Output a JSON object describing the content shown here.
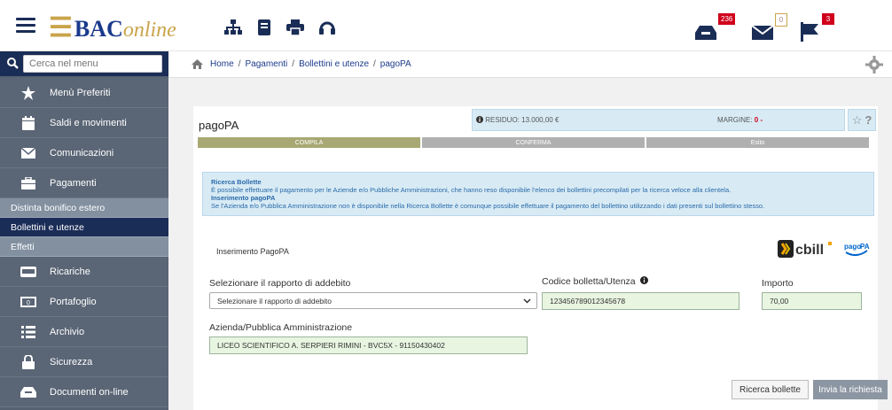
{
  "header": {
    "logo_bac": "BAC",
    "logo_online": "online",
    "notifications": [
      {
        "name": "inbox-icon",
        "count": "236"
      },
      {
        "name": "mail-icon",
        "count": "0"
      },
      {
        "name": "flag-icon",
        "count": "3"
      }
    ]
  },
  "sidebar": {
    "search_placeholder": "Cerca nel menu",
    "items": [
      {
        "icon": "star-icon",
        "label": "Menù Preferiti"
      },
      {
        "icon": "calendar-icon",
        "label": "Saldi e movimenti"
      },
      {
        "icon": "envelope-icon",
        "label": "Comunicazioni"
      },
      {
        "icon": "briefcase-icon",
        "label": "Pagamenti"
      }
    ],
    "subitems": [
      {
        "label": "Distinta bonifico estero",
        "active": false
      },
      {
        "label": "Bollettini e utenze",
        "active": true
      },
      {
        "label": "Effetti",
        "active": false
      }
    ],
    "items2": [
      {
        "icon": "card-icon",
        "label": "Ricariche"
      },
      {
        "icon": "wallet-icon",
        "label": "Portafoglio"
      },
      {
        "icon": "list-icon",
        "label": "Archivio"
      },
      {
        "icon": "lock-icon",
        "label": "Sicurezza"
      },
      {
        "icon": "inbox-icon",
        "label": "Documenti on-line"
      }
    ]
  },
  "breadcrumb": [
    "Home",
    "Pagamenti",
    "Bollettini e utenze",
    "pagoPA"
  ],
  "page": {
    "title": "pagoPA",
    "residuo_label": "RESIDUO: 13.000,00 €",
    "margine_label": "MARGINE:",
    "margine_value": "0 -",
    "steps": [
      "COMPILA",
      "CONFERMA",
      "Esito"
    ],
    "note": {
      "title1": "Ricerca Bollette",
      "text1": "È possibile effettuare il pagamento per le Aziende e/o Pubbliche Amministrazioni, che hanno reso disponibile l'elenco dei bollettini precompilati per la ricerca veloce alla clientela.",
      "title2": "Inserimento pagoPA",
      "text2": "Se l'Azienda e/o Pubblica Amministrazione non è disponibile nella Ricerca Bollette è comunque possibile effettuare il pagamento del bollettino utilizzando i dati presenti sul bollettino stesso."
    },
    "section_label": "Inserimento PagoPA",
    "form": {
      "rapporto_label": "Selezionare il rapporto di addebito",
      "rapporto_value": "Selezionare il rapporto di addebito",
      "codice_label": "Codice bolletta/Utenza",
      "codice_value": "123456789012345678",
      "importo_label": "Importo",
      "importo_value": "70,00",
      "azienda_label": "Azienda/Pubblica Amministrazione",
      "azienda_value": "LICEO SCIENTIFICO A. SERPIERI RIMINI - BVC5X - 91150430402"
    },
    "buttons": {
      "ricerca": "Ricerca bollette",
      "invia": "Invia la richiesta"
    }
  }
}
